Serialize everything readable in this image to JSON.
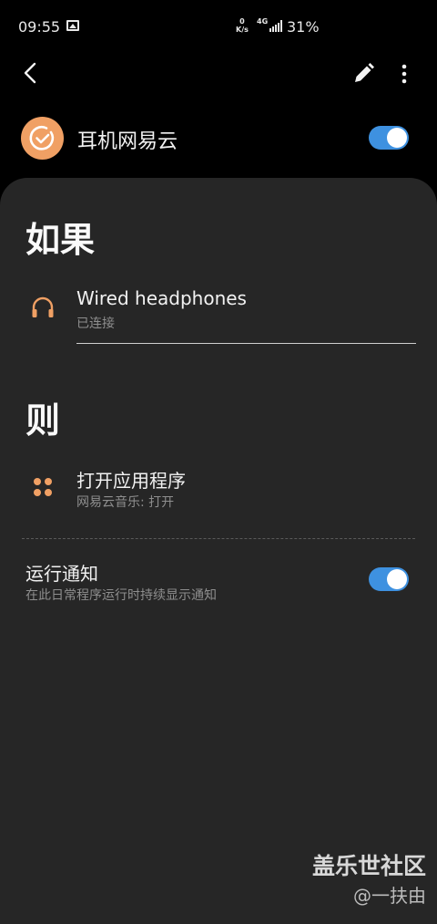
{
  "status_bar": {
    "time": "09:55",
    "speed_top": "0",
    "speed_unit": "K/s",
    "network": "4G",
    "battery": "31%"
  },
  "header": {
    "back_icon": "back-arrow-icon",
    "edit_icon": "pencil-icon",
    "more_icon": "more-vertical-icon"
  },
  "routine": {
    "name": "耳机网易云",
    "enabled": true,
    "icon_color": "#f0a064"
  },
  "if_section": {
    "heading": "如果",
    "condition": {
      "icon": "headphones-icon",
      "title": "Wired headphones",
      "subtitle": "已连接"
    }
  },
  "then_section": {
    "heading": "则",
    "action": {
      "icon": "apps-icon",
      "title": "打开应用程序",
      "subtitle": "网易云音乐: 打开"
    }
  },
  "notification": {
    "title": "运行通知",
    "subtitle": "在此日常程序运行时持续显示通知",
    "enabled": true
  },
  "watermark": {
    "site": "盖乐世社区",
    "user": "@一扶由"
  },
  "colors": {
    "accent": "#3e91e0",
    "icon_orange": "#f0a064",
    "panel": "#262626"
  }
}
